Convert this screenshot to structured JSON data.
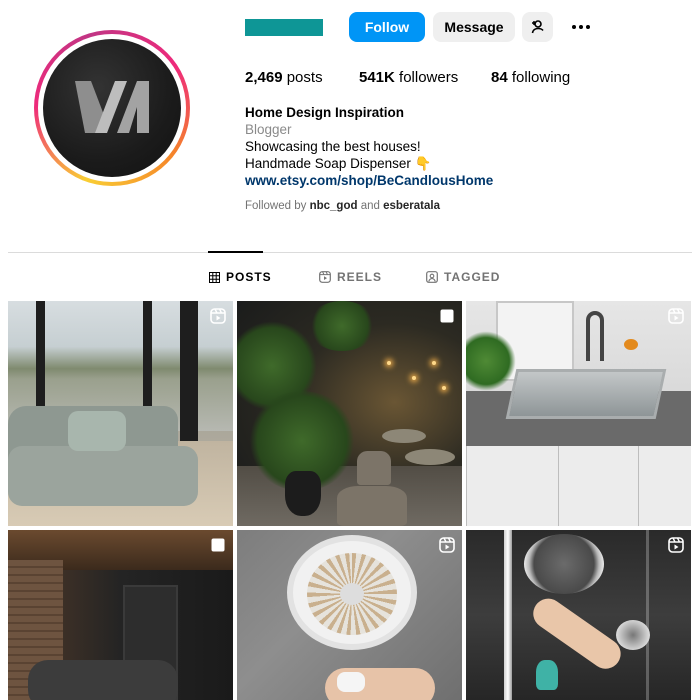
{
  "profile": {
    "follow_label": "Follow",
    "message_label": "Message",
    "stats": {
      "posts_count": "2,469",
      "posts_label": "posts",
      "followers_count": "541K",
      "followers_label": "followers",
      "following_count": "84",
      "following_label": "following"
    },
    "bio": {
      "name": "Home Design Inspiration",
      "category": "Blogger",
      "line1": "Showcasing the best houses!",
      "line2": "Handmade Soap Dispenser 👇",
      "link": "www.etsy.com/shop/BeCandlousHome"
    },
    "followed_by": {
      "prefix": "Followed by",
      "user1": "nbc_god",
      "conjunction": "and",
      "user2": "esberatala"
    }
  },
  "tabs": [
    {
      "label": "POSTS",
      "icon": "grid-icon",
      "active": true
    },
    {
      "label": "REELS",
      "icon": "reels-icon",
      "active": false
    },
    {
      "label": "TAGGED",
      "icon": "tagged-icon",
      "active": false
    }
  ],
  "posts": [
    {
      "badge": "reel-icon"
    },
    {
      "badge": "multiple-icon"
    },
    {
      "badge": "reel-icon"
    },
    {
      "badge": "multiple-icon"
    },
    {
      "badge": "reel-icon"
    },
    {
      "badge": "reel-icon"
    }
  ],
  "colors": {
    "follow_button": "#0095f6",
    "secondary_button": "#efefef",
    "link": "#00376b",
    "username_redaction": "#0e9696"
  }
}
